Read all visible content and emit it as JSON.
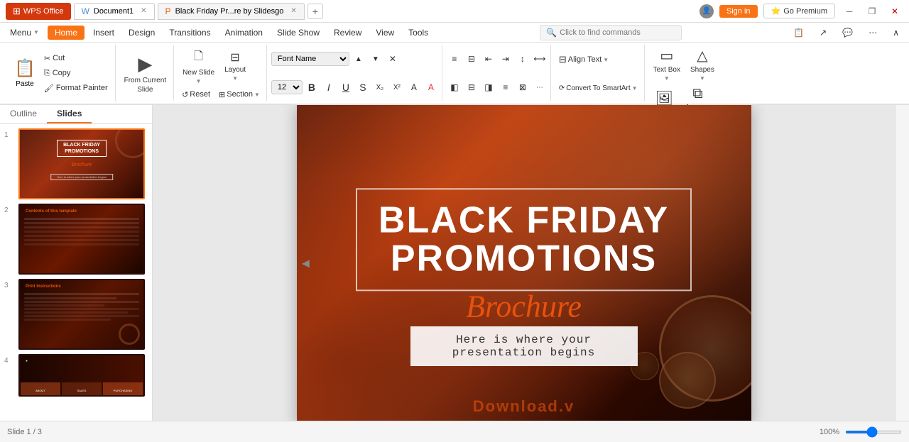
{
  "titleBar": {
    "wpsOffice": "WPS Office",
    "doc1Tab": "Document1",
    "pptxTab": "Black Friday Pr...re by Slidesgo",
    "newTabIcon": "+",
    "accountIcon": "👤",
    "signinLabel": "Sign in",
    "premiumLabel": "Go Premium",
    "minimizeIcon": "─",
    "maximizeIcon": "❐",
    "closeIcon": "✕"
  },
  "menuBar": {
    "menu": "Menu",
    "home": "Home",
    "insert": "Insert",
    "design": "Design",
    "transitions": "Transitions",
    "animation": "Animation",
    "slideShow": "Slide Show",
    "review": "Review",
    "view": "View",
    "tools": "Tools",
    "searchPlaceholder": "Click to find commands",
    "moreIcon": "⋯"
  },
  "toolbar": {
    "paste": "Paste",
    "cut": "Cut",
    "copy": "Copy",
    "formatPainter": "Format Painter",
    "fromCurrentSlide": "From Current",
    "fromCurrentSub": "Slide",
    "newSlide": "New Slide",
    "layout": "Layout",
    "reset": "Reset",
    "section": "Section",
    "textBox": "Text Box",
    "shapes": "Shapes",
    "picture": "Picture",
    "arrange": "Arrange",
    "alignText": "Align Text",
    "convertToSmartArt": "Convert To SmartArt",
    "bold": "B",
    "italic": "I",
    "underline": "U",
    "strikethrough": "S",
    "subscript": "X₂",
    "superscript": "X²",
    "clearFormatting": "A",
    "fontColor": "A",
    "fontSize1": "▲",
    "fontSize2": "▼",
    "clearFormat": "✕",
    "bulletList": "☰",
    "numberedList": "☷",
    "decreaseIndent": "⇤",
    "increaseIndent": "⇥",
    "lineSpacing": "↕",
    "textDirection": "↔"
  },
  "slidePanel": {
    "outlineTab": "Outline",
    "slidesTab": "Slides",
    "slides": [
      {
        "num": "1",
        "type": "title"
      },
      {
        "num": "2",
        "type": "content"
      },
      {
        "num": "3",
        "type": "print"
      },
      {
        "num": "4",
        "type": "tabs"
      }
    ]
  },
  "mainSlide": {
    "title1": "BLACK FRIDAY",
    "title2": "PROMOTIONS",
    "brochure": "Brochure",
    "subtitle": "Here is where your presentation begins",
    "watermark": "Download.v..."
  },
  "bottomBar": {
    "slideCount": "Slide 1 / 3",
    "zoom": "100%"
  }
}
